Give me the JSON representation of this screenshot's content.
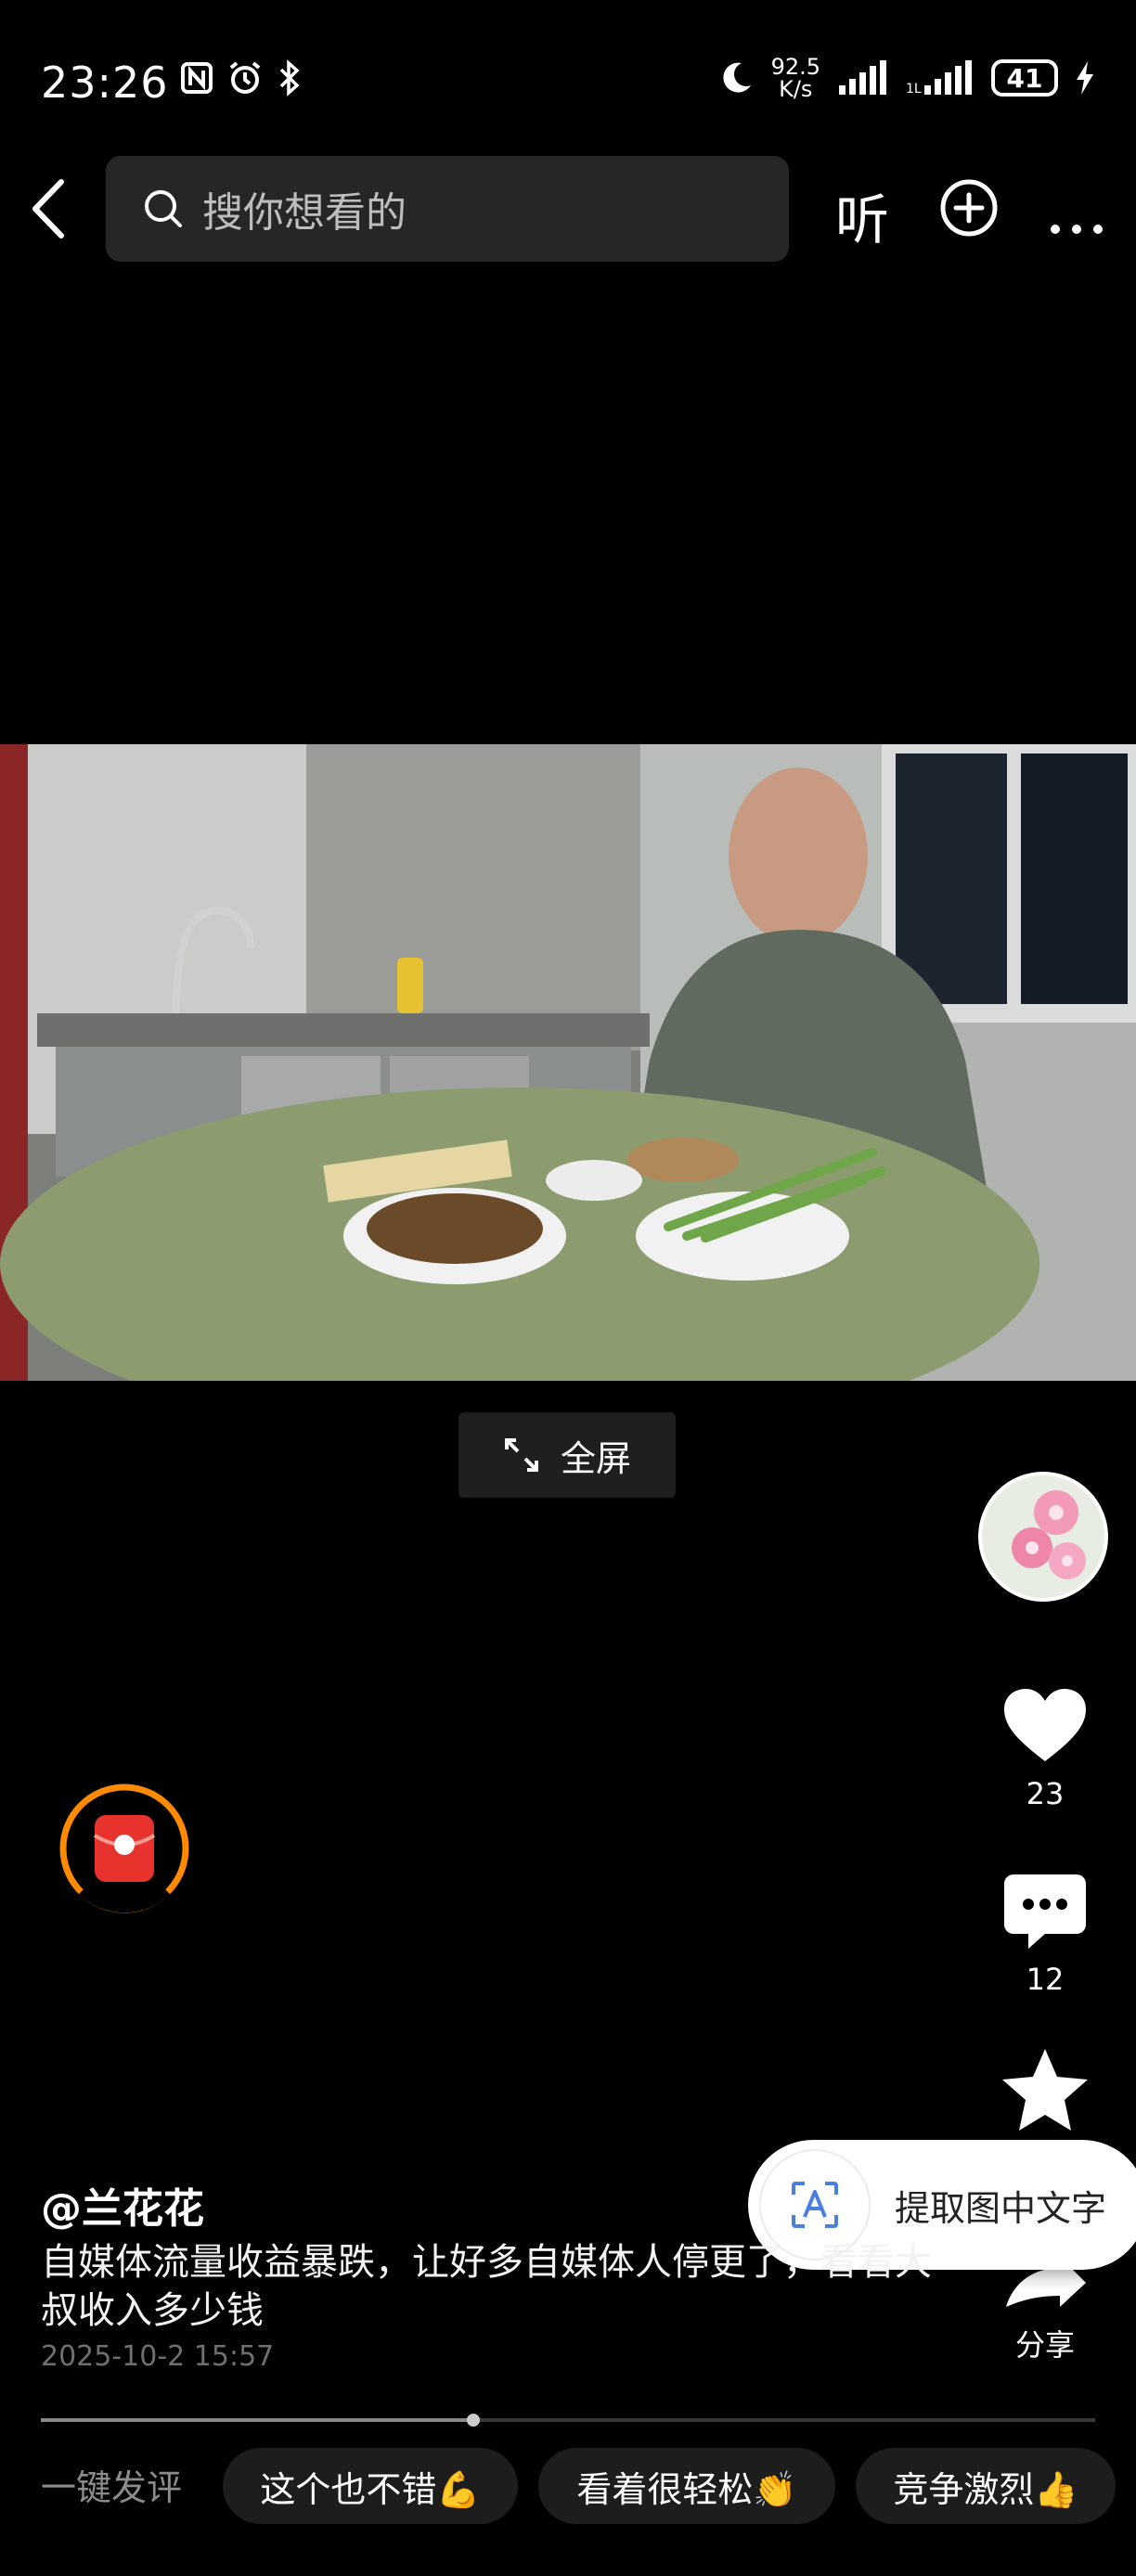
{
  "status_bar": {
    "time": "23:26",
    "net_speed_value": "92.5",
    "net_speed_unit": "K/s",
    "battery": "41"
  },
  "header": {
    "search_placeholder": "搜你想看的",
    "listen_label": "听"
  },
  "player": {
    "fullscreen_label": "全屏",
    "progress": 0.41
  },
  "actions": {
    "like_count": "23",
    "comment_count": "12",
    "share_label": "分享"
  },
  "post": {
    "author": "@兰花花",
    "description": "自媒体流量收益暴跌，让好多自媒体人停更了，看看大叔收入多少钱",
    "date": "2025-10-2 15:57"
  },
  "ocr_popup": {
    "label": "提取图中文字"
  },
  "quick_comment": {
    "label": "一键发评",
    "chips": [
      "这个也不错💪",
      "看着很轻松👏",
      "竞争激烈👍"
    ]
  },
  "colors": {
    "accent_orange": "#ff8a00",
    "red_packet": "#e8322e",
    "background": "#000000"
  }
}
